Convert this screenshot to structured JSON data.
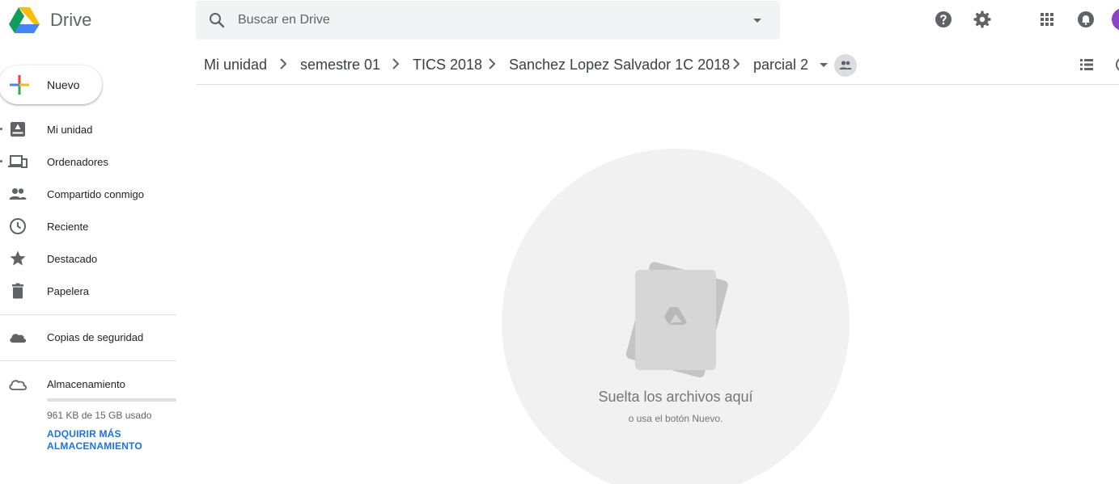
{
  "app": {
    "brand": "Drive"
  },
  "search": {
    "placeholder": "Buscar en Drive"
  },
  "header_icons": [
    "help-icon",
    "settings-icon",
    "apps-grid-icon",
    "notifications-icon"
  ],
  "breadcrumb": [
    "Mi unidad",
    "semestre 01",
    "TICS 2018",
    "Sanchez Lopez Salvador 1C 2018",
    "parcial 2"
  ],
  "sidebar": {
    "new_label": "Nuevo",
    "items": [
      {
        "label": "Mi unidad",
        "icon": "my-drive-icon"
      },
      {
        "label": "Ordenadores",
        "icon": "computers-icon"
      },
      {
        "label": "Compartido conmigo",
        "icon": "shared-people-icon"
      },
      {
        "label": "Reciente",
        "icon": "clock-icon"
      },
      {
        "label": "Destacado",
        "icon": "star-icon"
      },
      {
        "label": "Papelera",
        "icon": "trash-icon"
      }
    ],
    "backups": {
      "label": "Copias de seguridad",
      "icon": "cloud-icon"
    },
    "storage": {
      "label": "Almacenamiento",
      "icon": "cloud-outline-icon",
      "used_text": "961 KB de 15 GB usado",
      "used_fraction": 0.0001,
      "buy_label": "ADQUIRIR MÁS ALMACENAMIENTO"
    }
  },
  "empty_state": {
    "title": "Suelta los archivos aquí",
    "subtitle": "o usa el botón Nuevo."
  },
  "colors": {
    "accent": "#1a73e8",
    "search_bg": "#f1f3f4",
    "avatar": "#8e44c8"
  }
}
